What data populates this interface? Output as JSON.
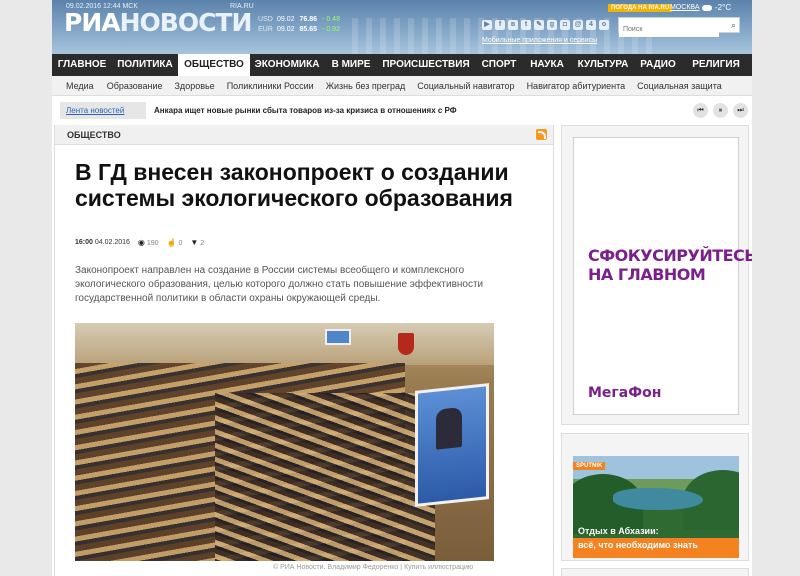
{
  "header": {
    "date": "09.02.2016",
    "time": "12:44 МСК",
    "logo_ria": "РИА",
    "logo_novosti": "НОВОСТИ",
    "logo_domain": "RIA.RU",
    "rates": [
      {
        "currency": "USD",
        "date": "09.02",
        "value": "76.86",
        "change": "- 0.48"
      },
      {
        "currency": "EUR",
        "date": "09.02",
        "value": "85.65",
        "change": "- 0.92"
      }
    ],
    "weather_button": "ПОГОДА НА RIA.RU",
    "city": "МОСКВА",
    "temperature": "-2°C",
    "search_placeholder": "Поиск",
    "mobile_link": "Мобильные приложения и сервисы",
    "social_icons": [
      "youtube-icon",
      "facebook-icon",
      "vk-icon",
      "twitter-icon",
      "livejournal-icon",
      "googleplus-icon",
      "instagram-icon",
      "mail-icon",
      "foursquare-icon",
      "odnoklassniki-icon"
    ]
  },
  "nav": {
    "items": [
      {
        "label": "ГЛАВНОЕ",
        "active": false
      },
      {
        "label": "ПОЛИТИКА",
        "active": false
      },
      {
        "label": "ОБЩЕСТВО",
        "active": true
      },
      {
        "label": "ЭКОНОМИКА",
        "active": false
      },
      {
        "label": "В МИРЕ",
        "active": false
      },
      {
        "label": "ПРОИСШЕСТВИЯ",
        "active": false
      },
      {
        "label": "СПОРТ",
        "active": false
      },
      {
        "label": "НАУКА",
        "active": false
      },
      {
        "label": "КУЛЬТУРА",
        "active": false
      },
      {
        "label": "РАДИО",
        "active": false
      },
      {
        "label": "РЕЛИГИЯ",
        "active": false
      }
    ]
  },
  "subnav": {
    "items": [
      "Медиа",
      "Образование",
      "Здоровье",
      "Поликлиники России",
      "Жизнь без преград",
      "Социальный навигатор",
      "Навигатор абитуриента",
      "Социальная защита"
    ]
  },
  "ticker": {
    "label": "Лента новостей",
    "headline": "Анкара ищет новые рынки сбыта товаров из-за кризиса в отношениях с РФ"
  },
  "article": {
    "section": "ОБЩЕСТВО",
    "title": "В ГД внесен законопроект о создании системы экологического образования",
    "time": "16:00",
    "date": "04.02.2016",
    "views": "190",
    "likes": "0",
    "comments": "2",
    "lead": "Законопроект направлен на создание в России системы всеобщего и комплексного экологического образования, целью которого должно стать повышение эффективности государственной политики в области охраны окружающей среды.",
    "photo_credit": "© РИА Новости. Владимир Федоренко",
    "photo_buy": "Купить иллюстрацию"
  },
  "sidebar": {
    "ad1_slogan": "СФОКУСИРУЙТЕСЬ НА ГЛАВНОМ",
    "ad1_brand": "МегаФон",
    "ad2_badge": "SPUTNIK",
    "ad2_line1": "Отдых в Абхазии:",
    "ad2_line2": "всё, что необходимо знать"
  },
  "colors": {
    "header_blue": "#7c9fc3",
    "nav_dark": "#2b2b2b",
    "megafon_purple": "#7a1f8c",
    "megafon_green": "#00a84f",
    "sputnik_orange": "#f58220"
  }
}
